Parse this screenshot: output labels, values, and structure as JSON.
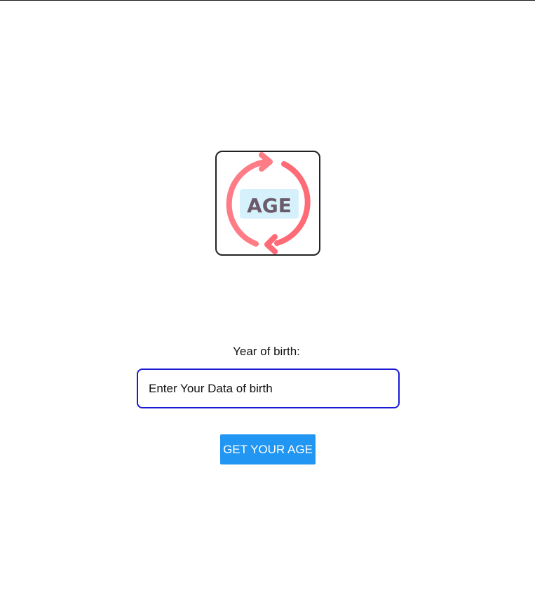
{
  "logo": {
    "icon": "age-cycle-icon",
    "text": "AGE",
    "colors": {
      "arrow": "#fe6b76",
      "badge_bg": "#d6f1fb",
      "badge_text": "#6a5a6a"
    }
  },
  "form": {
    "label": "Year of birth:",
    "input_placeholder": "Enter Your Data of birth",
    "input_value": "",
    "input_border_color": "#1a1ad6"
  },
  "button": {
    "label": "GET YOUR AGE",
    "color": "#2196f3"
  }
}
